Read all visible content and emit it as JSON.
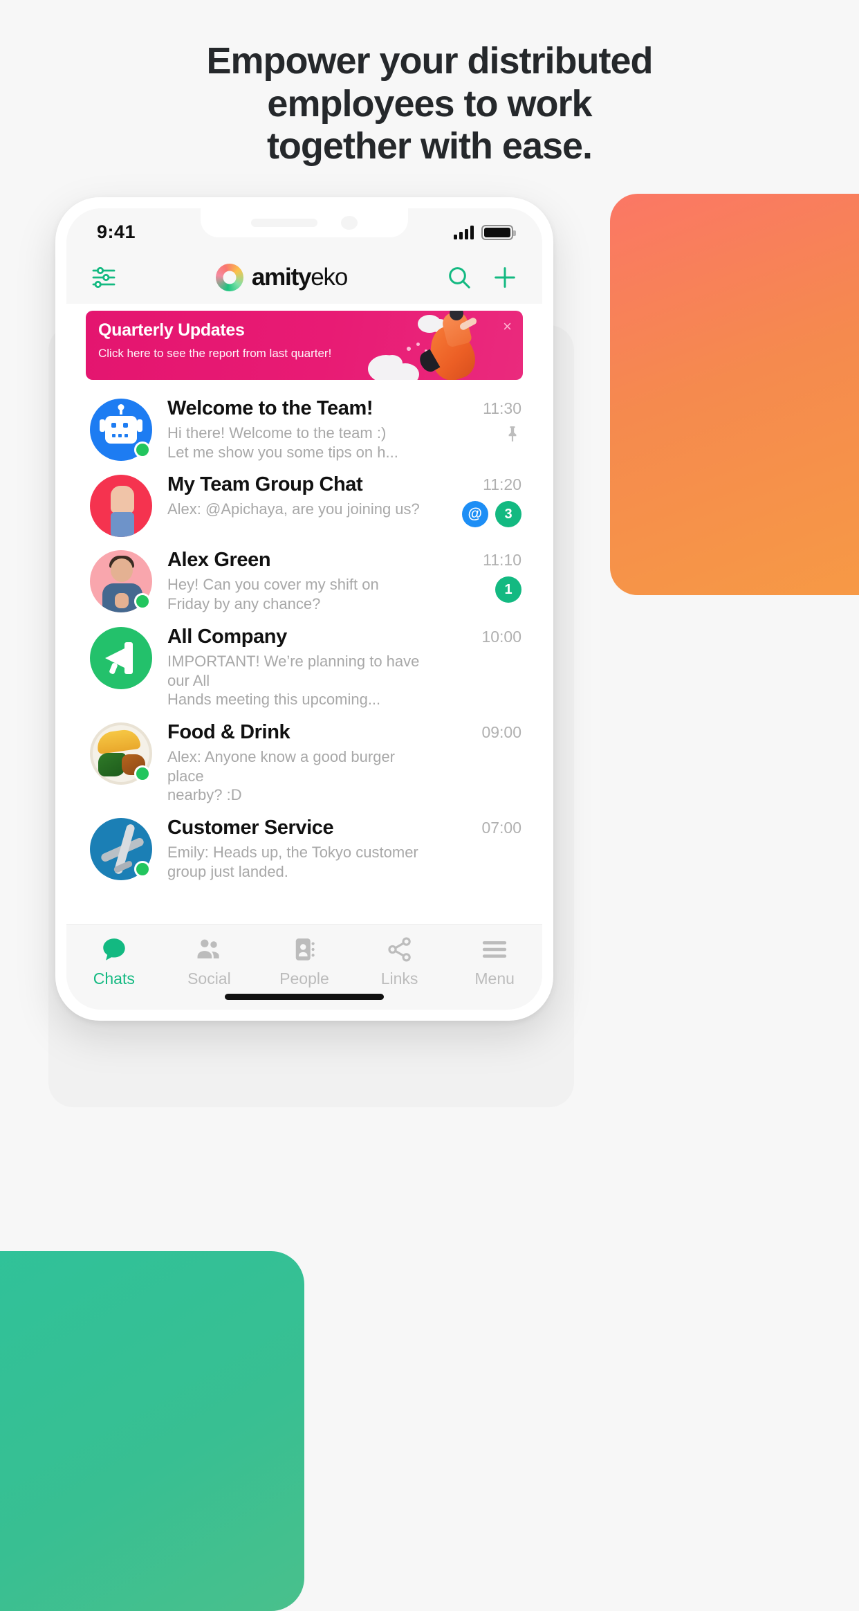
{
  "headline": {
    "line1": "Empower your distributed",
    "line2": "employees to work",
    "line3": "together with ease."
  },
  "status_bar": {
    "time": "9:41",
    "signal_icon": "signal-bars-icon",
    "battery_icon": "battery-full-icon"
  },
  "app_header": {
    "filter_icon": "sliders-filter-icon",
    "brand_bold": "amity",
    "brand_light": "eko",
    "search_icon": "search-icon",
    "add_icon": "plus-icon"
  },
  "banner": {
    "title": "Quarterly Updates",
    "subtitle": "Click here to see the report\nfrom last quarter!",
    "close_label": "×"
  },
  "chats": [
    {
      "avatar": "robot-avatar",
      "title": "Welcome to the Team!",
      "preview": "Hi there! Welcome to the team :)\nLet me show you some tips on h...",
      "time": "11:30",
      "online": true,
      "pinned": true,
      "pin_glyph": "📌",
      "mention": null,
      "unread": null
    },
    {
      "avatar": "waving-hand-avatar",
      "title": "My Team Group Chat",
      "preview": "Alex: @Apichaya, are you joining us?",
      "time": "11:20",
      "online": false,
      "pinned": false,
      "mention": "@",
      "unread": "3"
    },
    {
      "avatar": "person-photo-avatar",
      "title": "Alex Green",
      "preview": "Hey! Can you cover my shift on\nFriday by any chance?",
      "time": "11:10",
      "online": true,
      "pinned": false,
      "mention": null,
      "unread": "1"
    },
    {
      "avatar": "megaphone-avatar",
      "title": "All Company",
      "preview": "IMPORTANT! We’re planning to have our All\nHands meeting this upcoming...",
      "time": "10:00",
      "online": false,
      "pinned": false,
      "mention": null,
      "unread": null
    },
    {
      "avatar": "food-photo-avatar",
      "title": "Food & Drink",
      "preview": "Alex: Anyone know a good burger place\nnearby? :D",
      "time": "09:00",
      "online": true,
      "pinned": false,
      "mention": null,
      "unread": null
    },
    {
      "avatar": "airplane-photo-avatar",
      "title": "Customer Service",
      "preview": "Emily: Heads up, the Tokyo customer\ngroup just landed.",
      "time": "07:00",
      "online": true,
      "pinned": false,
      "mention": null,
      "unread": null
    }
  ],
  "tabs": [
    {
      "label": "Chats",
      "icon": "chat-bubble-icon",
      "active": true
    },
    {
      "label": "Social",
      "icon": "people-group-icon",
      "active": false
    },
    {
      "label": "People",
      "icon": "contact-card-icon",
      "active": false
    },
    {
      "label": "Links",
      "icon": "share-nodes-icon",
      "active": false
    },
    {
      "label": "Menu",
      "icon": "hamburger-menu-icon",
      "active": false
    }
  ],
  "colors": {
    "accent_green": "#13b981",
    "banner_pink": "#e4156f",
    "text_dark": "#111111",
    "text_muted": "#a8a8a8",
    "mention_blue": "#1d8ef5"
  }
}
